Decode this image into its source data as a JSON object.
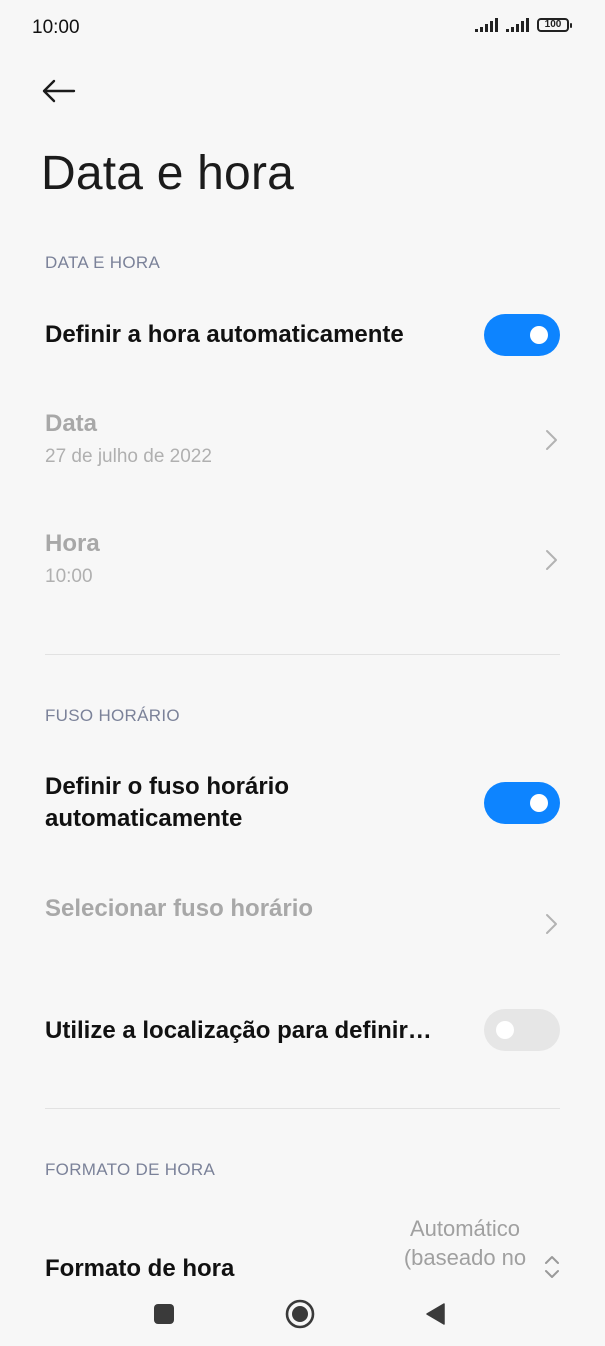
{
  "status_bar": {
    "time": "10:00",
    "battery": "100"
  },
  "header": {
    "title": "Data e hora"
  },
  "sections": {
    "date_time": {
      "header": "DATA E HORA",
      "auto_time": {
        "label": "Definir a hora automaticamente",
        "enabled": true
      },
      "date": {
        "label": "Data",
        "value": "27 de julho de 2022"
      },
      "time": {
        "label": "Hora",
        "value": "10:00"
      }
    },
    "timezone": {
      "header": "FUSO HORÁRIO",
      "auto_tz": {
        "label_line1": "Definir o fuso horário",
        "label_line2": "automaticamente",
        "enabled": true
      },
      "select_tz": {
        "label": "Selecionar fuso horário"
      },
      "use_location": {
        "label": "Utilize a localização para definir…",
        "enabled": false
      }
    },
    "time_format": {
      "header": "FORMATO DE HORA",
      "format": {
        "label": "Formato de hora",
        "value_line1": "Automático",
        "value_line2": "(baseado no"
      }
    }
  },
  "colors": {
    "accent": "#0d84ff",
    "section_header": "#7b8299",
    "disabled_text": "#a8a8a8"
  },
  "icons": {
    "back": "arrow-left-icon",
    "chevron": "chevron-right-icon",
    "nav_recent": "square-icon",
    "nav_home": "circle-icon",
    "nav_back": "triangle-icon"
  }
}
